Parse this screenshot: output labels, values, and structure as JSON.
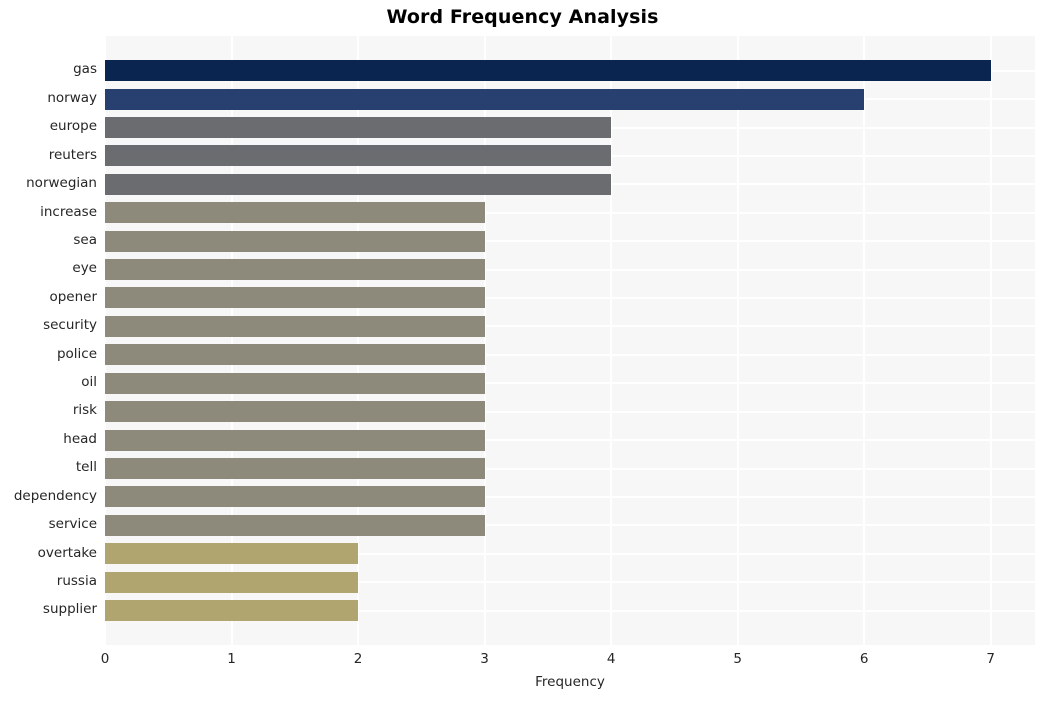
{
  "chart_data": {
    "type": "bar",
    "orientation": "horizontal",
    "title": "Word Frequency Analysis",
    "xlabel": "Frequency",
    "ylabel": "",
    "xlim": [
      0,
      7.35
    ],
    "xticks": [
      0,
      1,
      2,
      3,
      4,
      5,
      6,
      7
    ],
    "xtick_labels": [
      "0",
      "1",
      "2",
      "3",
      "4",
      "5",
      "6",
      "7"
    ],
    "grid": true,
    "legend": null,
    "categories": [
      "gas",
      "norway",
      "europe",
      "reuters",
      "norwegian",
      "increase",
      "sea",
      "eye",
      "opener",
      "security",
      "police",
      "oil",
      "risk",
      "head",
      "tell",
      "dependency",
      "service",
      "overtake",
      "russia",
      "supplier"
    ],
    "values": [
      7,
      6,
      4,
      4,
      4,
      3,
      3,
      3,
      3,
      3,
      3,
      3,
      3,
      3,
      3,
      3,
      3,
      2,
      2,
      2
    ],
    "bar_colors": [
      "#0a2550",
      "#27406f",
      "#6a6c70",
      "#6a6c70",
      "#6a6c70",
      "#8e8a7b",
      "#8e8a7b",
      "#8e8a7b",
      "#8e8a7b",
      "#8e8a7b",
      "#8e8a7b",
      "#8e8a7b",
      "#8e8a7b",
      "#8e8a7b",
      "#8e8a7b",
      "#8e8a7b",
      "#8e8a7b",
      "#b0a56e",
      "#b0a56e",
      "#b0a56e"
    ],
    "plot_background": "#f7f7f7",
    "gridline_color": "#ffffff",
    "figure_background": "#ffffff",
    "text_color": "#262626",
    "title_color": "#000000"
  }
}
